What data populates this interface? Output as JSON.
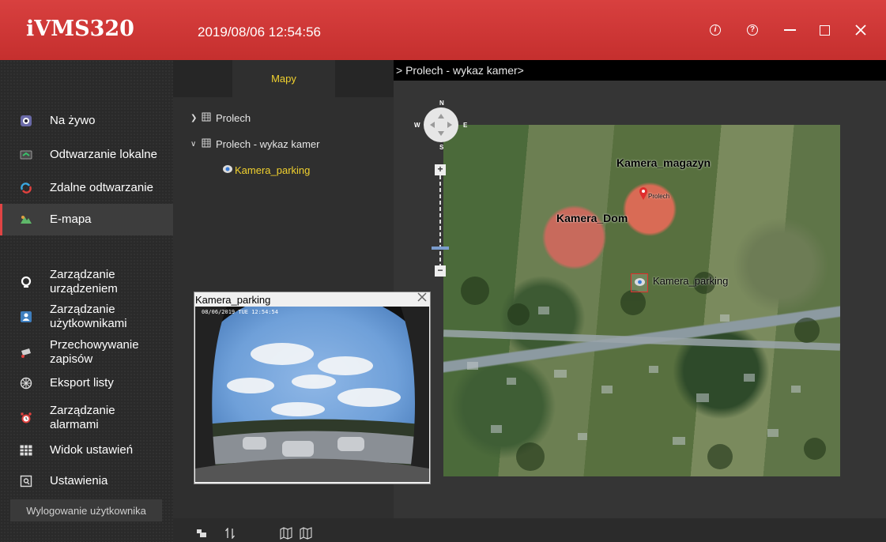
{
  "app": {
    "logo": "iVMS320",
    "datetime": "2019/08/06 12:54:56",
    "window_controls": [
      "info-icon",
      "help-icon",
      "minimize-icon",
      "maximize-icon",
      "close-icon"
    ]
  },
  "sidebar": {
    "items": [
      {
        "id": "na-zywo",
        "label": "Na żywo",
        "icon": "live-view-icon"
      },
      {
        "id": "odtwarzanie-lokalne",
        "label": "Odtwarzanie lokalne",
        "icon": "local-playback-icon"
      },
      {
        "id": "zdalne-odtwarzanie",
        "label": "Zdalne odtwarzanie",
        "icon": "remote-playback-icon"
      },
      {
        "id": "e-mapa",
        "label": "E-mapa",
        "icon": "emap-icon",
        "active": true
      },
      {
        "id": "zarzadzanie-urzadzeniem",
        "label": "Zarządzanie\nurządzeniem",
        "icon": "device-management-icon"
      },
      {
        "id": "zarzadzanie-uzytkownikami",
        "label": "Zarządzanie\nużytkownikami",
        "icon": "user-management-icon"
      },
      {
        "id": "przechowywanie-zapisow",
        "label": "Przechowywanie\nzapisów",
        "icon": "storage-icon"
      },
      {
        "id": "eksport-listy",
        "label": "Eksport listy",
        "icon": "export-icon"
      },
      {
        "id": "zarzadzanie-alarmami",
        "label": "Zarządzanie\nalarmami",
        "icon": "alarm-clock-icon"
      },
      {
        "id": "widok-ustawien",
        "label": "Widok ustawień",
        "icon": "grid-view-icon"
      },
      {
        "id": "ustawienia",
        "label": "Ustawienia",
        "icon": "settings-icon"
      }
    ],
    "logout_label": "Wylogowanie użytkownika"
  },
  "panel": {
    "tab_label": "Mapy",
    "tree": [
      {
        "label": "Prolech",
        "expanded": false
      },
      {
        "label": "Prolech - wykaz kamer",
        "expanded": true
      },
      {
        "label": "Kamera_parking",
        "type": "camera"
      }
    ]
  },
  "map": {
    "breadcrumb": "> Prolech - wykaz kamer>",
    "compass": {
      "n": "N",
      "s": "S",
      "w": "W",
      "e": "E"
    },
    "labels": {
      "kamera_magazyn": "Kamera_magazyn",
      "kamera_dom": "Kamera_Dom",
      "kamera_parking": "Kamera_parking",
      "prolech_pin": "Prolech"
    }
  },
  "popup": {
    "title": "Kamera_parking",
    "osd": "08/06/2019 TUE 12:54:54"
  },
  "colors": {
    "titlebar": "#c93634",
    "accent_yellow": "#f1d12e",
    "active_marker": "#e04444"
  }
}
